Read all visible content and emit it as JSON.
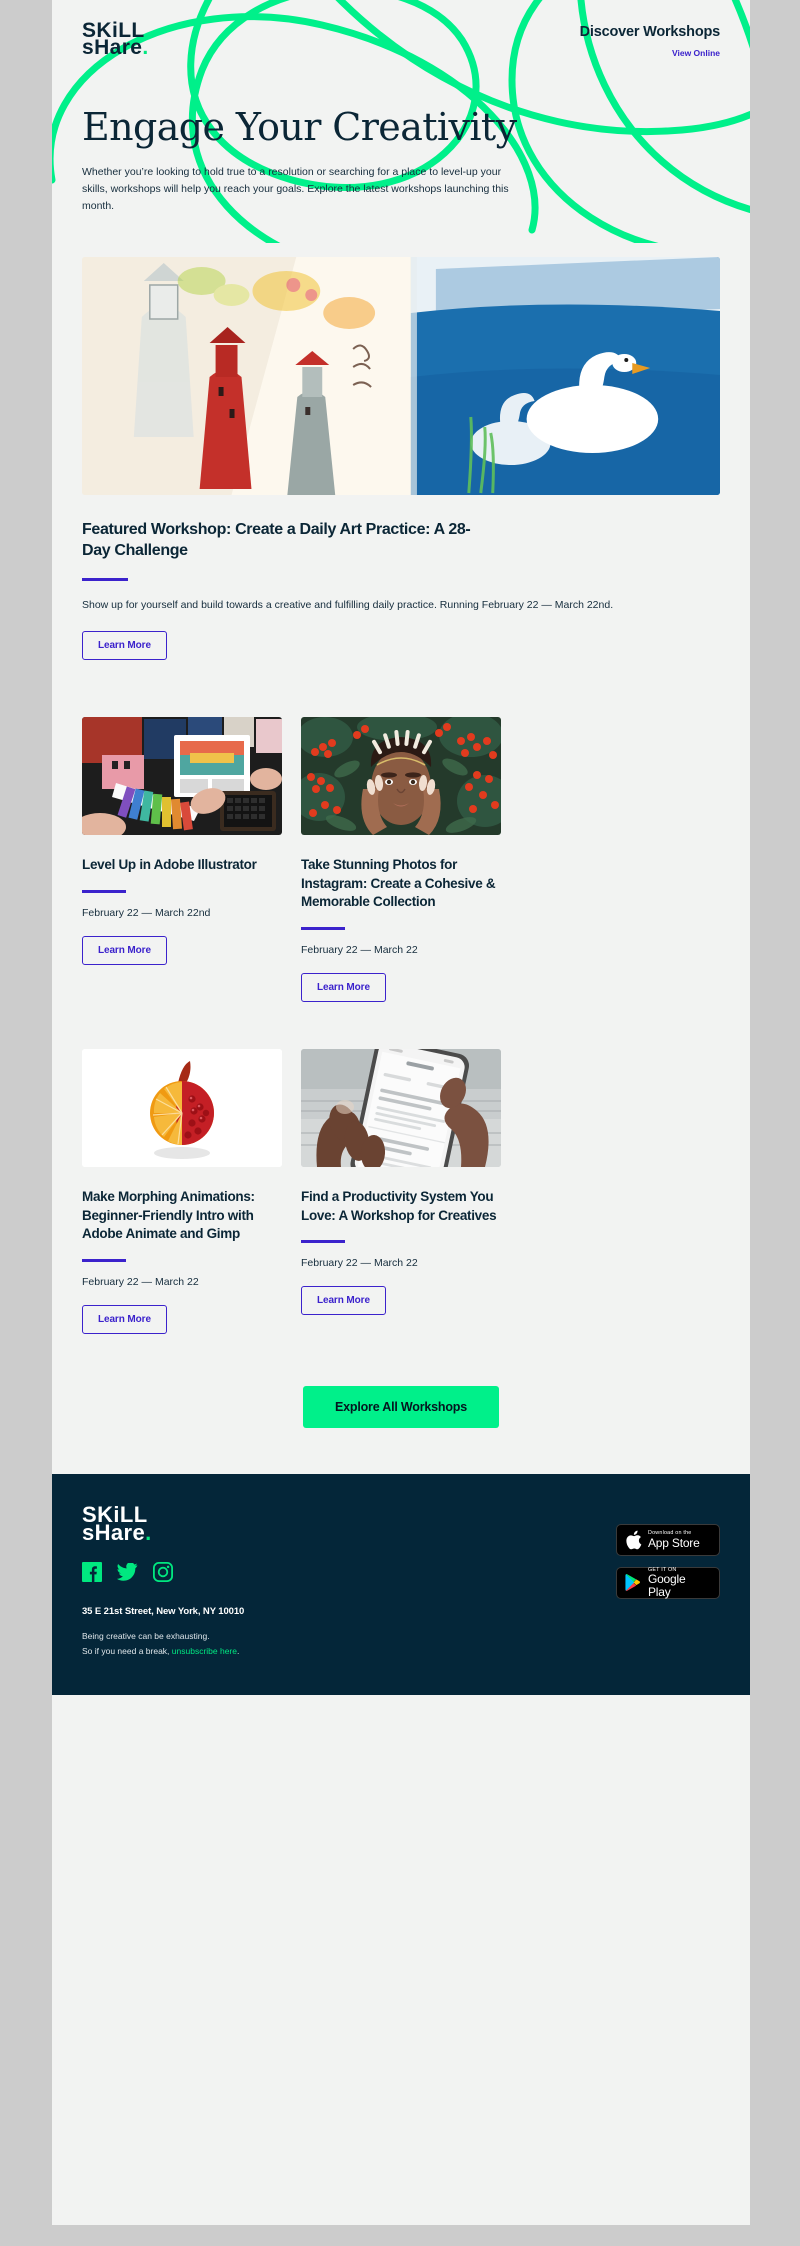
{
  "brand": {
    "logo_line1": "SKiLL",
    "logo_line2": "sHare",
    "logo_dot": ".",
    "accent_green": "#00f08a",
    "accent_purple": "#3b22cc",
    "navy": "#042639"
  },
  "header": {
    "discover_label": "Discover Workshops",
    "view_online_label": "View Online"
  },
  "hero": {
    "title": "Engage Your Creativity",
    "body": "Whether you’re looking to hold true to a resolution or searching for a place to level-up your skills, workshops will help you reach your goals. Explore the latest workshops launching this month."
  },
  "featured": {
    "image_alt": "watercolor-sketchbook-photo",
    "title": "Featured Workshop: Create a Daily Art Practice: A 28-Day Challenge",
    "description": "Show up for yourself and build towards a creative and fulfilling daily practice. Running February 22 — March 22nd.",
    "button_label": "Learn More"
  },
  "workshops": [
    {
      "image_alt": "color-swatches-design-photo",
      "title": "Level Up in Adobe Illustrator",
      "date": "February 22 — March 22nd",
      "button_label": "Learn More"
    },
    {
      "image_alt": "portrait-with-berries-photo",
      "title": "Take Stunning Photos for Instagram: Create a Cohesive & Memorable Collection",
      "date": "February 22 — March 22",
      "button_label": "Learn More"
    },
    {
      "image_alt": "orange-pomegranate-morph-photo",
      "title": "Make Morphing Animations: Beginner-Friendly Intro with Adobe Animate and Gimp",
      "date": "February 22 — March 22",
      "button_label": "Learn More"
    },
    {
      "image_alt": "hands-holding-phone-photo",
      "title": "Find a Productivity System You Love: A Workshop for Creatives",
      "date": "February 22 — March 22",
      "button_label": "Learn More"
    }
  ],
  "cta": {
    "label": "Explore All Workshops"
  },
  "footer": {
    "logo_line1": "SKiLL",
    "logo_line2": "sHare",
    "logo_dot": ".",
    "socials": [
      {
        "name": "facebook-icon"
      },
      {
        "name": "twitter-icon"
      },
      {
        "name": "instagram-icon"
      }
    ],
    "address": "35 E 21st Street, New York, NY 10010",
    "note_line1": "Being creative can be exhausting.",
    "note_line2_prefix": "So if you need a break, ",
    "unsubscribe_label": "unsubscribe here",
    "note_line2_suffix": ".",
    "app_store": {
      "small": "Download on the",
      "big": "App Store"
    },
    "google_play": {
      "small": "GET IT ON",
      "big": "Google Play"
    }
  }
}
